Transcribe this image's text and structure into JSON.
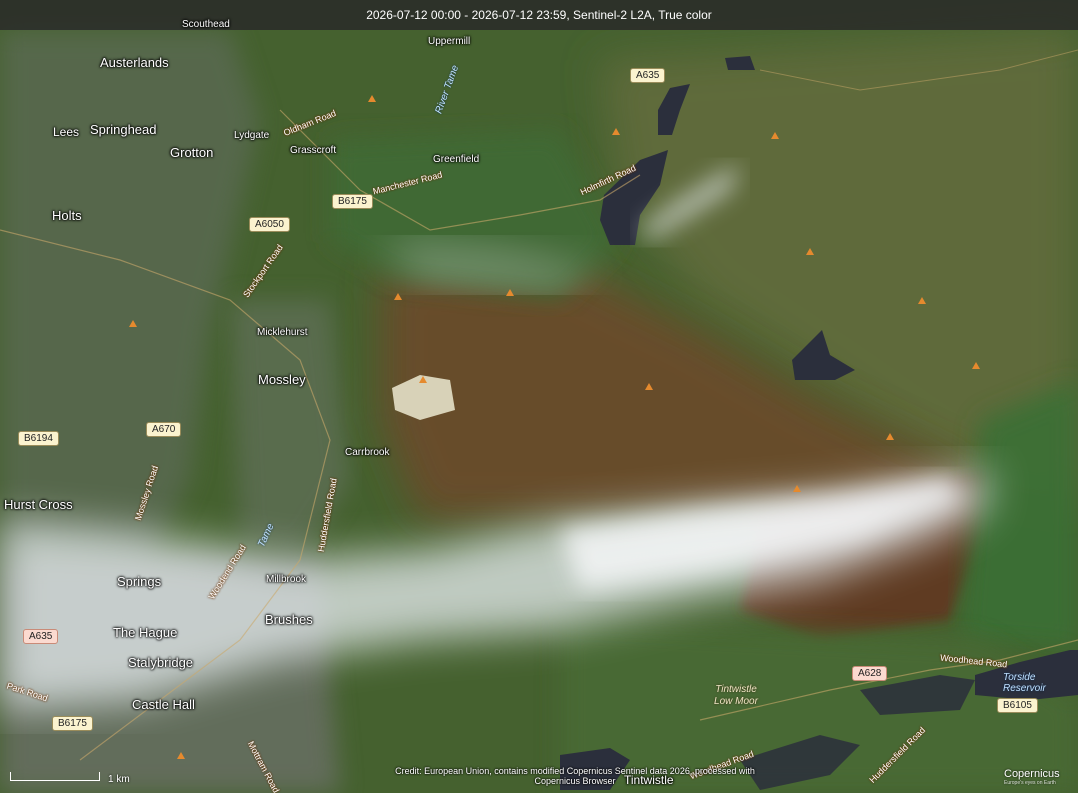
{
  "header": {
    "title": "2026-07-12 00:00 - 2026-07-12 23:59, Sentinel-2 L2A, True color"
  },
  "places": {
    "austerlands": "Austerlands",
    "springhead": "Springhead",
    "lees": "Lees",
    "grotton": "Grotton",
    "holts": "Holts",
    "lydgate": "Lydgate",
    "grasscroft": "Grasscroft",
    "uppermill": "Uppermill",
    "greenfield": "Greenfield",
    "scouthead": "Scouthead",
    "micklehurst": "Micklehurst",
    "mossley": "Mossley",
    "carrbrook": "Carrbrook",
    "hurst_cross": "Hurst Cross",
    "springs": "Springs",
    "millbrook": "Millbrook",
    "brushes": "Brushes",
    "the_hague": "The Hague",
    "stalybridge": "Stalybridge",
    "castle_hall": "Castle Hall",
    "tintwistle": "Tintwistle"
  },
  "roads": {
    "a635_top": "A635",
    "b6175_top": "B6175",
    "a6050": "A6050",
    "a670": "A670",
    "b6194": "B6194",
    "a635_left": "A635",
    "b6175_bottom": "B6175",
    "a628": "A628",
    "b6105": "B6105"
  },
  "road_names": {
    "oldham_road": "Oldham Road",
    "manchester_road": "Manchester Road",
    "holmfirth_road": "Holmfirth Road",
    "stockport_road": "Stockport Road",
    "mossley_road": "Mossley Road",
    "huddersfield_road": "Huddersfield Road",
    "woodend_road": "Woodend Road",
    "park_road": "Park Road",
    "woodhead_road_east": "Woodhead Road",
    "woodhead_road_south": "Woodhead Road",
    "huddersfield_road_top": "Huddersfield Road",
    "mottram_road": "Mottram Road"
  },
  "water": {
    "river_tame": "River Tame",
    "torside_reservoir": "Torside Reservoir",
    "tame_small": "Tame"
  },
  "moor": {
    "tintwistle_low_moor": "Tintwistle Low Moor"
  },
  "scale": {
    "label": "1 km"
  },
  "credit": {
    "line1": "Credit: European Union, contains modified Copernicus Sentinel data 2026, processed with",
    "line2": "Copernicus Browser"
  },
  "logo": {
    "name": "Copernicus",
    "tagline": "Europe's eyes on Earth"
  },
  "colors": {
    "peak_marker": "#e58a2e",
    "smoke": "#e8eef2",
    "burn_scar": "#5e3a22",
    "water": "#2a3040"
  }
}
